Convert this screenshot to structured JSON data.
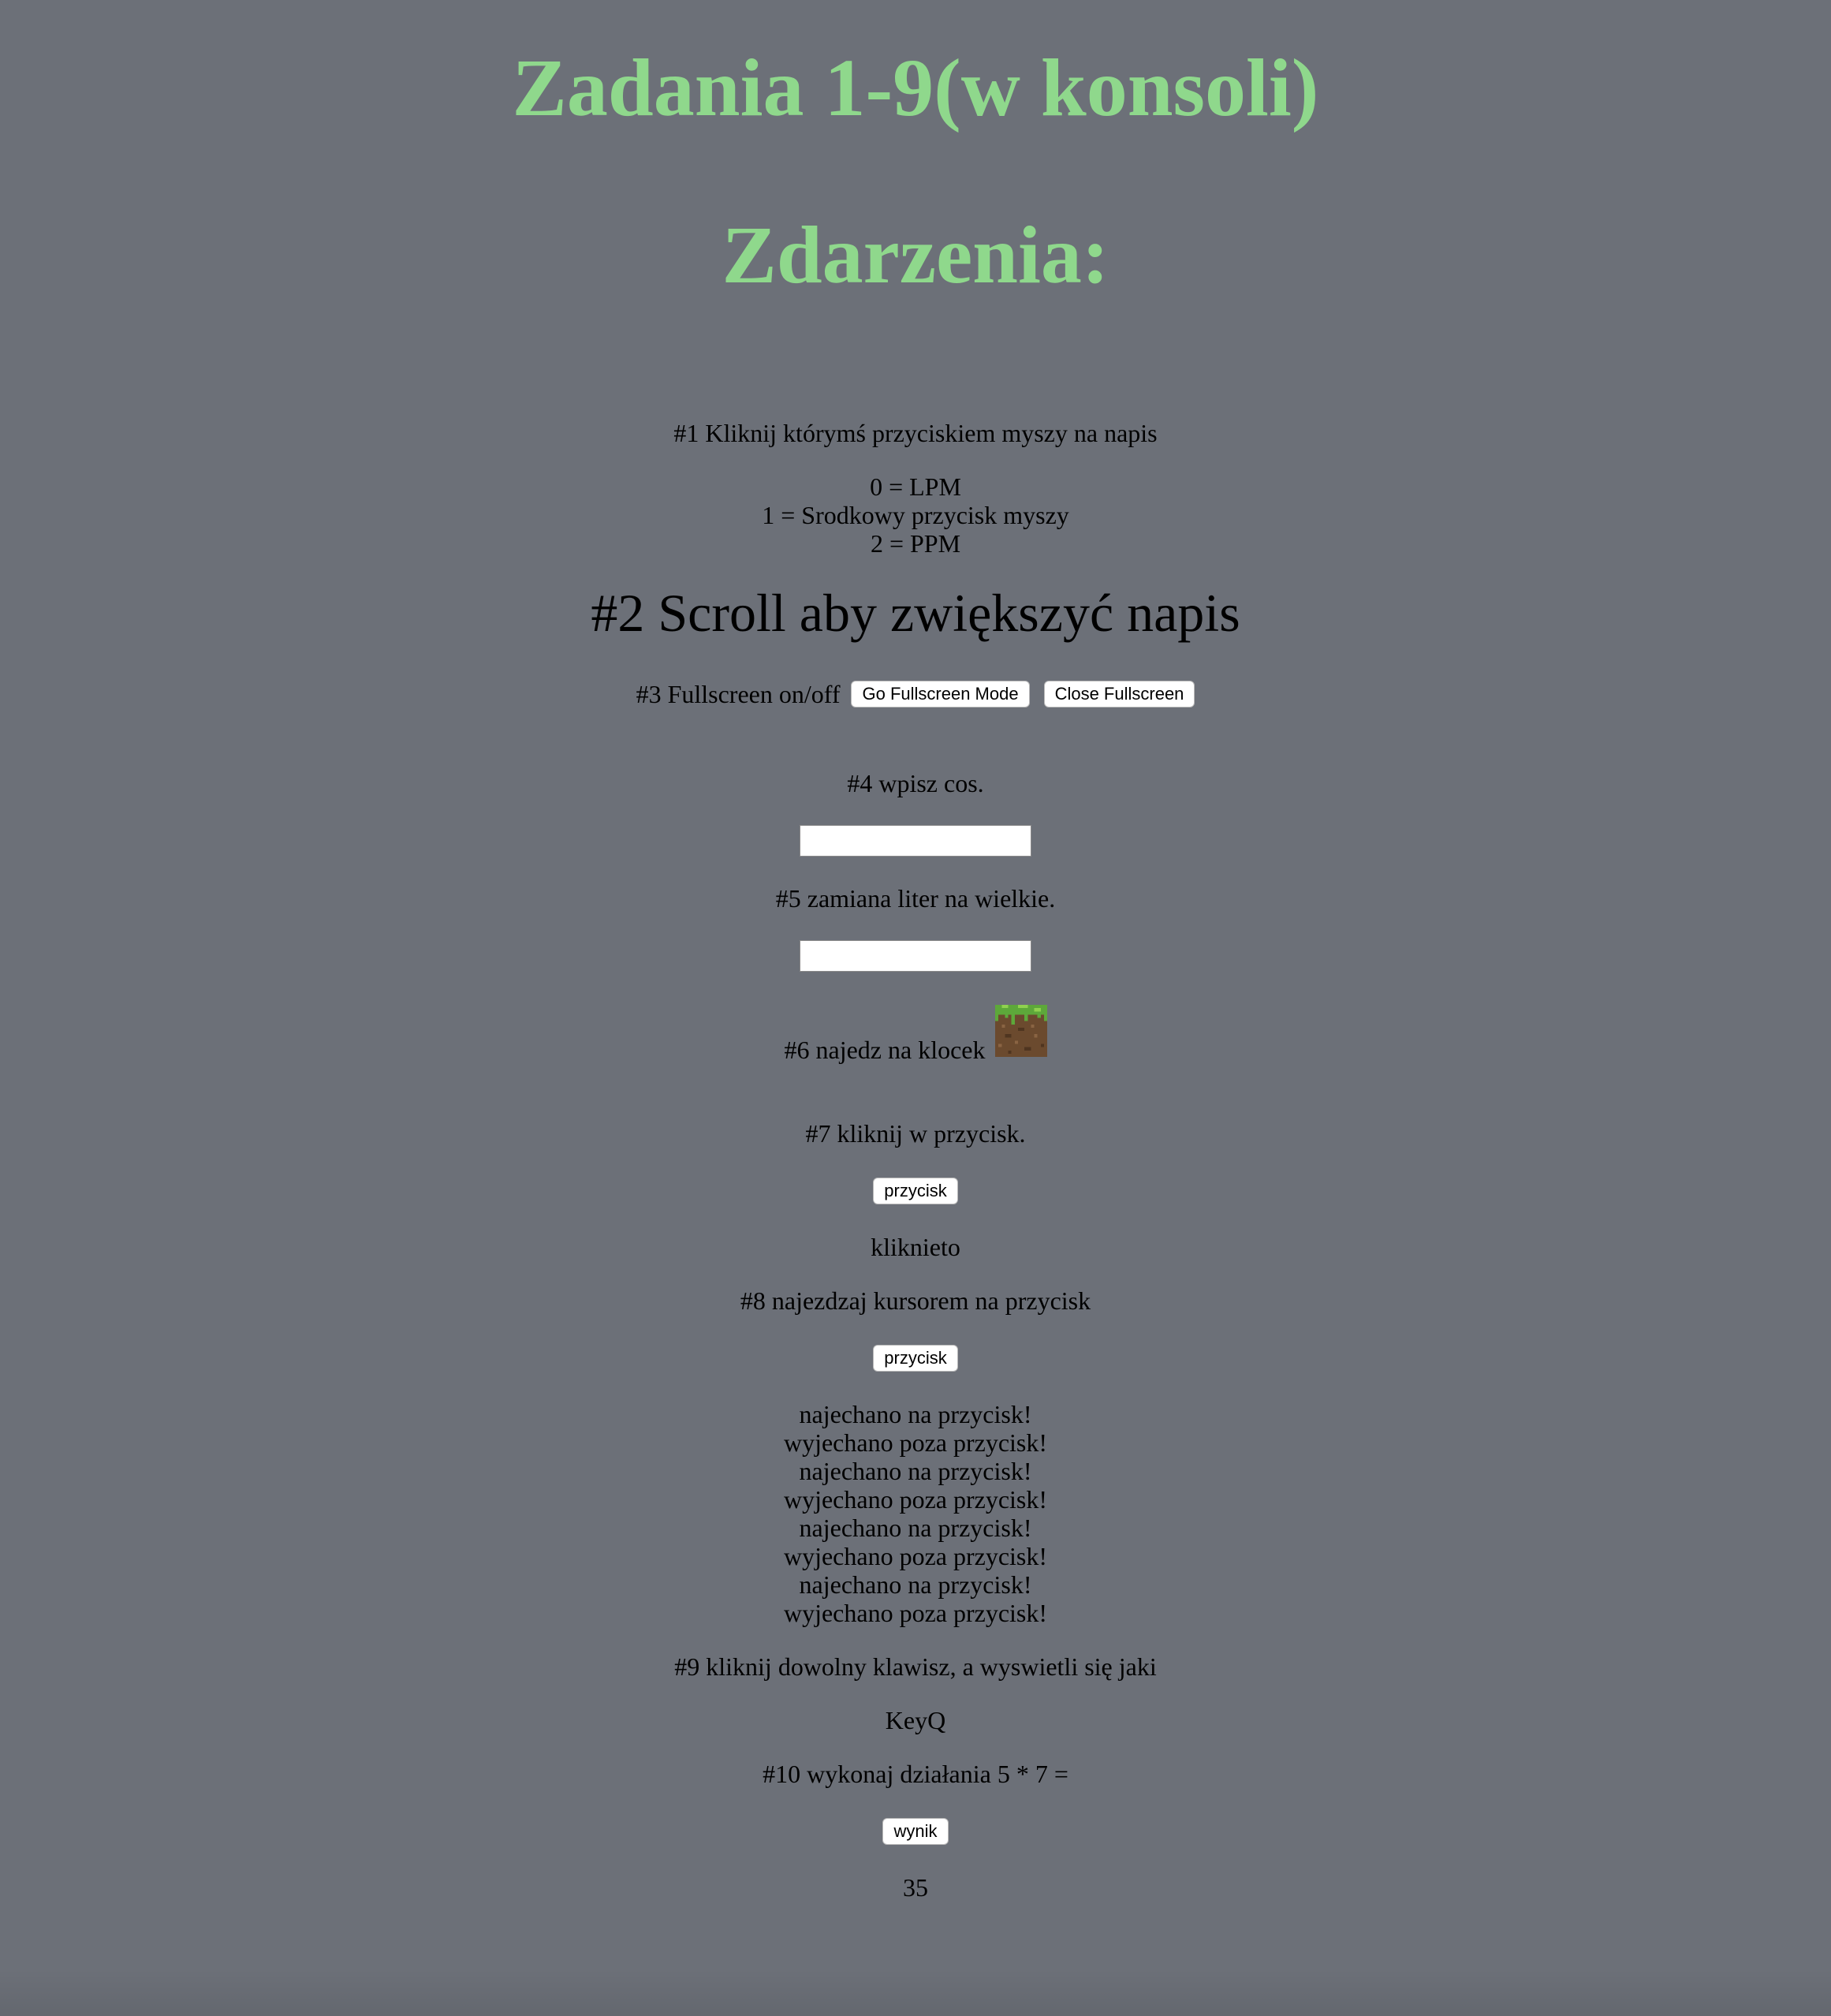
{
  "headings": {
    "title": "Zadania 1-9(w konsoli)",
    "events": "Zdarzenia:"
  },
  "task1": {
    "instruction": "#1 Kliknij którymś przyciskiem myszy na napis",
    "legend": [
      "0 = LPM",
      "1 = Srodkowy przycisk myszy",
      "2 = PPM"
    ]
  },
  "task2": {
    "label": "#2 Scroll aby zwiększyć napis"
  },
  "task3": {
    "label": "#3 Fullscreen on/off",
    "go_button": "Go Fullscreen Mode",
    "close_button": "Close Fullscreen"
  },
  "task4": {
    "label": "#4 wpisz cos.",
    "input_value": ""
  },
  "task5": {
    "label": "#5 zamiana liter na wielkie.",
    "input_value": ""
  },
  "task6": {
    "label": "#6 najedz na klocek",
    "image_icon": "minecraft-grass-block-icon"
  },
  "task7": {
    "label": "#7 kliknij w przycisk.",
    "button": "przycisk",
    "result": "kliknieto"
  },
  "task8": {
    "label": "#8 najezdzaj kursorem na przycisk",
    "button": "przycisk",
    "log": [
      "najechano na przycisk!",
      "wyjechano poza przycisk!",
      "najechano na przycisk!",
      "wyjechano poza przycisk!",
      "najechano na przycisk!",
      "wyjechano poza przycisk!",
      "najechano na przycisk!",
      "wyjechano poza przycisk!"
    ]
  },
  "task9": {
    "label": "#9 kliknij dowolny klawisz, a wyswietli się jaki",
    "result": "KeyQ"
  },
  "task10": {
    "label": "#10 wykonaj działania 5 * 7 =",
    "button": "wynik",
    "result": "35"
  },
  "colors": {
    "background": "#6c7078",
    "heading": "#8fd88c"
  }
}
